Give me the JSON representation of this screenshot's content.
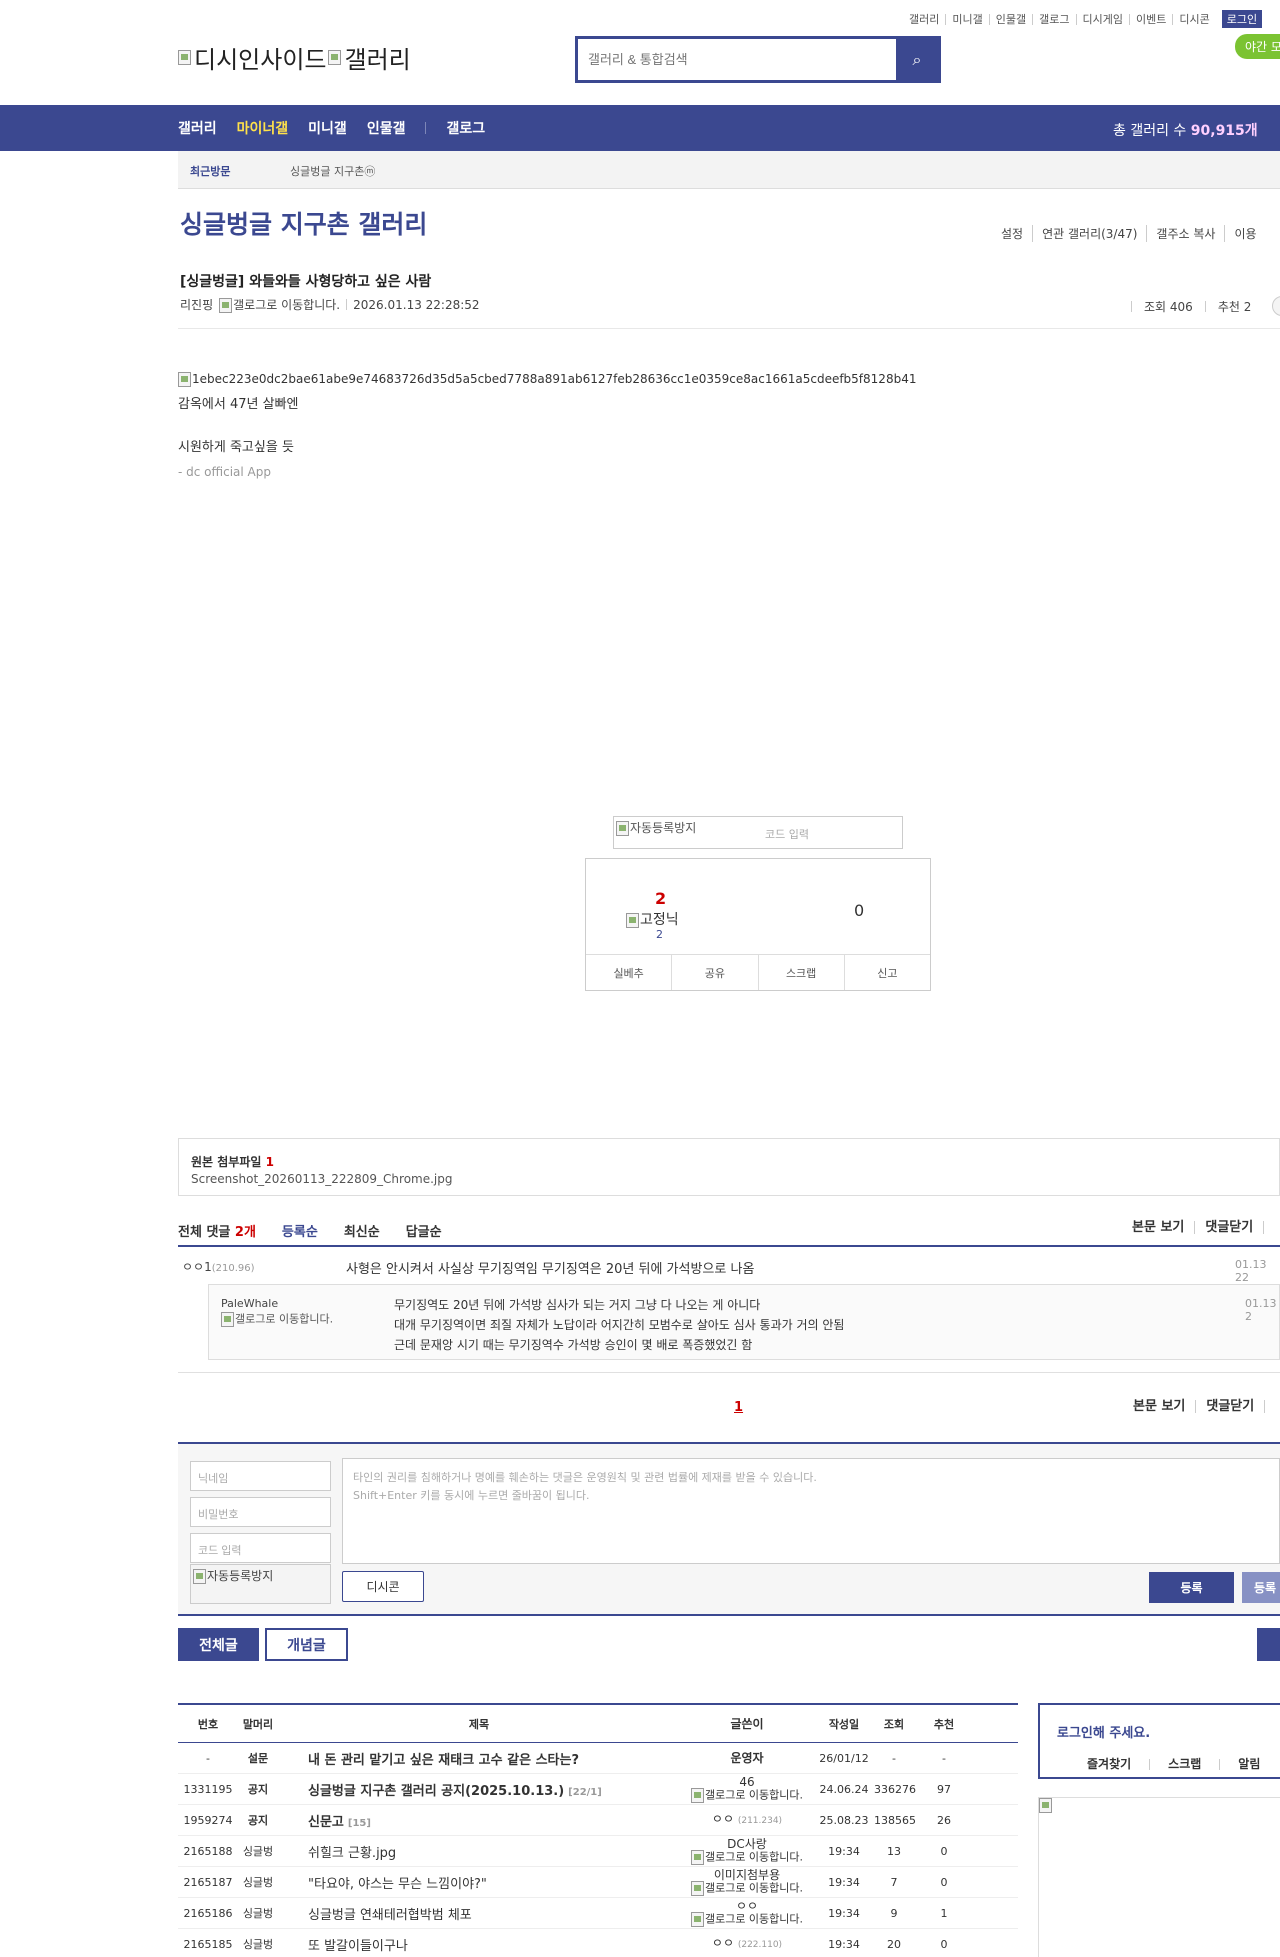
{
  "header": {
    "util_links": [
      "갤러리",
      "미니갤",
      "인물갤",
      "갤로그",
      "디시게임",
      "이벤트",
      "디시콘"
    ],
    "login": "로그인",
    "night_mode": "야간 모",
    "logo_alt_1": "디시인사이드",
    "logo_alt_2": "갤러리",
    "search_placeholder": "갤러리 & 통합검색"
  },
  "gnb": {
    "items": [
      "갤러리",
      "마이너갤",
      "미니갤",
      "인물갤",
      "갤로그"
    ],
    "total_label": "총 갤러리 수",
    "total_count": "90,915개"
  },
  "recent": {
    "label": "최근방문",
    "item": "싱글벙글 지구촌ⓜ"
  },
  "gallery": {
    "title": "싱글벙글 지구촌 갤러리",
    "util": [
      "설정",
      "연관 갤러리(3/47)",
      "갤주소 복사",
      "이용"
    ]
  },
  "post": {
    "title": "[싱글벙글] 와들와들 사형당하고 싶은 사람",
    "author": "리진핑",
    "gallog_alt": "갤로그로 이동합니다.",
    "date": "2026.01.13 22:28:52",
    "views": "조회 406",
    "recommend": "추천 2",
    "image_alt": "1ebec223e0dc2bae61abe9e74683726d35d5a5cbed7788a891ab6127feb28636cc1e0359ce8ac1661a5cdeefb5f8128b41",
    "line1": "감옥에서 47년 살빠엔",
    "line2": "시원하게 죽고싶을 듯",
    "app_sign": "- dc official App"
  },
  "captcha": {
    "img_alt": "자동등록방지",
    "placeholder": "코드 입력"
  },
  "recommend_box": {
    "up": "2",
    "fix_alt": "고정닉",
    "fix_count": "2",
    "down": "0",
    "buttons": [
      "실베추",
      "공유",
      "스크랩",
      "신고"
    ]
  },
  "attachment": {
    "label": "원본 첨부파일",
    "count": "1",
    "file": "Screenshot_20260113_222809_Chrome.jpg"
  },
  "comments": {
    "total_label": "전체 댓글",
    "total_count": "2개",
    "sort": [
      "등록순",
      "최신순",
      "답글순"
    ],
    "actions": [
      "본문 보기",
      "댓글닫기"
    ],
    "c1_nick": "ㅇㅇ1",
    "c1_ip": "(210.96)",
    "c1_text": "사형은 안시켜서 사실상 무기징역임 무기징역은 20년 뒤에 가석방으로 나옴",
    "c1_date": "01.13 22",
    "r1_nick": "PaleWhale",
    "r1_gallog": "갤로그로 이동합니다.",
    "r1_line1": "무기징역도 20년 뒤에 가석방 심사가 되는 거지 그냥 다 나오는 게 아니다",
    "r1_line2": "대개 무기징역이면 죄질 자체가 노답이라 어지간히 모범수로 살아도 심사 통과가 거의 안됨",
    "r1_line3": "근데 문재앙 시기 때는 무기징역수 가석방 승인이 몇 배로 폭증했었긴 함",
    "r1_date": "01.13 2",
    "page": "1"
  },
  "write": {
    "nick_ph": "닉네임",
    "pw_ph": "비밀번호",
    "code_ph": "코드 입력",
    "captcha_alt": "자동등록방지",
    "textarea_line1": "타인의 권리를 침해하거나 명예를 훼손하는 댓글은 운영원칙 및 관련 법률에 제재를 받을 수 있습니다.",
    "textarea_line2": "Shift+Enter 키를 동시에 누르면 줄바꿈이 됩니다.",
    "dccon": "디시콘",
    "submit": "등록",
    "submit2": "등록"
  },
  "tabs": [
    "전체글",
    "개념글"
  ],
  "list": {
    "headers": [
      "번호",
      "말머리",
      "제목",
      "글쓴이",
      "작성일",
      "조회",
      "추천"
    ],
    "rows": [
      {
        "no": "-",
        "head": "설문",
        "title": "내 돈 관리 맡기고 싶은 재태크 고수 같은 스타는?",
        "rc": "",
        "writer": "운영자",
        "ip": "",
        "date": "26/01/12",
        "views": "-",
        "rec": "-"
      },
      {
        "no": "1331195",
        "head": "공지",
        "title": "싱글벙글 지구촌 갤러리 공지(2025.10.13.)",
        "rc": "[22/1]",
        "writer": "46",
        "ip": "",
        "date": "24.06.24",
        "views": "336276",
        "rec": "97"
      },
      {
        "no": "1959274",
        "head": "공지",
        "title": "신문고",
        "rc": "[15]",
        "writer": "ㅇㅇ",
        "ip": "(211.234)",
        "date": "25.08.23",
        "views": "138565",
        "rec": "26"
      },
      {
        "no": "2165188",
        "head": "싱글벙",
        "title": "쉬힐크 근황.jpg",
        "rc": "",
        "writer": "DC사랑",
        "ip": "",
        "date": "19:34",
        "views": "13",
        "rec": "0"
      },
      {
        "no": "2165187",
        "head": "싱글벙",
        "title": "\"타요야, 야스는 무슨 느낌이야?\"",
        "rc": "",
        "writer": "이미지첨부용",
        "ip": "",
        "date": "19:34",
        "views": "7",
        "rec": "0"
      },
      {
        "no": "2165186",
        "head": "싱글벙",
        "title": "싱글벙글 연쇄테러협박범 체포",
        "rc": "",
        "writer": "ㅇㅇ",
        "ip": "",
        "date": "19:34",
        "views": "9",
        "rec": "1"
      },
      {
        "no": "2165185",
        "head": "싱글벙",
        "title": "또 발갈이들이구나",
        "rc": "",
        "writer": "ㅇㅇ",
        "ip": "(222.110)",
        "date": "19:34",
        "views": "20",
        "rec": "0"
      }
    ],
    "gallog_alt": "갤로그로 이동합니다."
  },
  "login_box": {
    "title": "로그인해 주세요.",
    "links": [
      "즐겨찾기",
      "스크랩",
      "알림"
    ]
  },
  "colors": {
    "brand": "#3b4890",
    "accent": "#ffe14a",
    "red": "#cc0000"
  }
}
